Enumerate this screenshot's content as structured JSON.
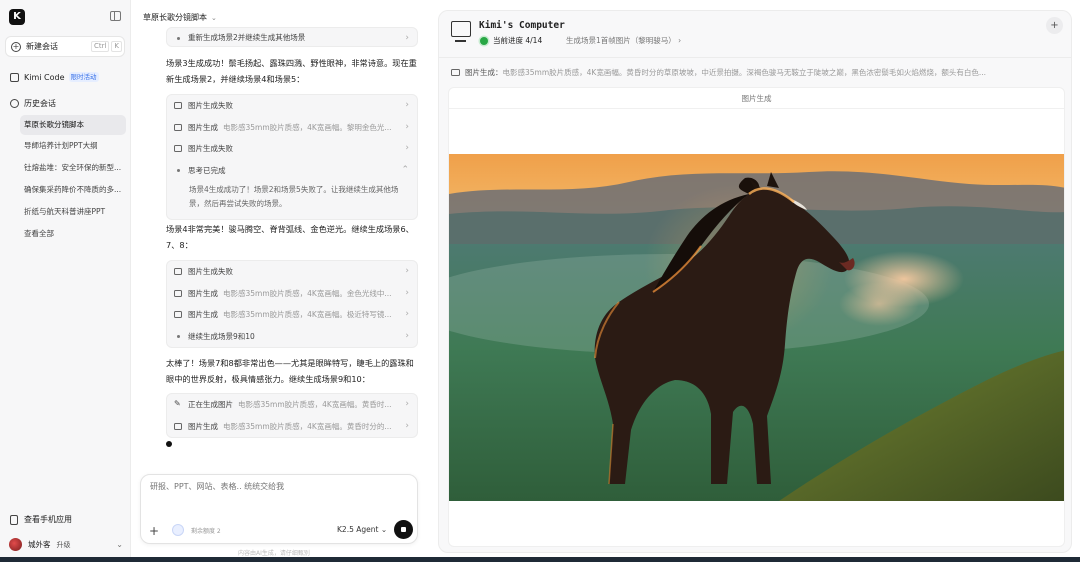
{
  "sidebar": {
    "logo": "K",
    "new_chat": {
      "label": "新建会话",
      "shortcut_ctrl": "Ctrl",
      "shortcut_key": "K"
    },
    "kimi_code": {
      "label": "Kimi Code",
      "badge": "限时活动"
    },
    "history_header": "历史会话",
    "history": [
      "草原长歌分镜脚本",
      "导師培养计划PPT大纲",
      "钍熔盐堆：安全环保的新型...",
      "确保集采药降价不降质的多...",
      "折纸与航天科普讲座PPT",
      "查看全部"
    ],
    "mobile_app": "查看手机应用",
    "user_name": "城外客",
    "upgrade": "升级"
  },
  "chat": {
    "title": "草原长歌分镜脚本",
    "top_step": "重新生成场景2并继续生成其他场景",
    "para1": "场景3生成成功！鬃毛扬起、露珠四溅、野性眼神，非常诗意。现在重新生成场景2，并继续场景4和场景5：",
    "card1": [
      {
        "label": "图片生成失败",
        "detail": ""
      },
      {
        "label": "图片生成",
        "detail": "电影感35mm胶片质感，4K宽画幅。黎明金色光..."
      },
      {
        "label": "图片生成失败",
        "detail": ""
      },
      {
        "label": "思考已完成",
        "detail": ""
      }
    ],
    "think_body": "场景4生成成功了！场景2和场景5失败了。让我继续生成其他场景，然后再尝试失败的场景。",
    "para2": "场景4非常完美！骏马腾空、脊背弧线、金色逆光。继续生成场景6、7、8：",
    "card2": [
      {
        "label": "图片生成失败",
        "detail": ""
      },
      {
        "label": "图片生成",
        "detail": "电影感35mm胶片质感，4K宽画幅。金色光线中..."
      },
      {
        "label": "图片生成",
        "detail": "电影感35mm胶片质感，4K宽画幅。极近特写镜..."
      },
      {
        "label": "继续生成场景9和10",
        "detail": ""
      }
    ],
    "para3": "太棒了！场景7和8都非常出色——尤其是眼眸特写，睫毛上的露珠和眼中的世界反射，极具情感张力。继续生成场景9和10：",
    "card3": [
      {
        "label": "正在生成图片",
        "detail": "电影感35mm胶片质感，4K宽画幅。黄昏时..."
      },
      {
        "label": "图片生成",
        "detail": "电影感35mm胶片质感，4K宽画幅。黄昏时分的..."
      }
    ],
    "input_placeholder": "研报、PPT、网站、表格.. 统统交给我",
    "remaining": "剩余额度 2",
    "agent": "K2.5 Agent",
    "footnote": "内容由AI生成，请仔细甄别"
  },
  "panel": {
    "title": "Kimi's Computer",
    "progress": "当前进度 4/14",
    "progress_detail": "生成场景1首帧图片（黎明骏马）",
    "tool_label": "图片生成",
    "tool_detail": "电影感35mm胶片质感，4K宽画幅。黄昏时分的草原坡坡，中近景拍摄。深褐色骏马无鞍立于陡坡之巅，黑色浓密鬃毛如火焰燃烧，额头有白色...",
    "viewer_label": "图片生成"
  },
  "colors": {
    "accent_green": "#28a745",
    "badge_blue": "#3a72e8"
  }
}
